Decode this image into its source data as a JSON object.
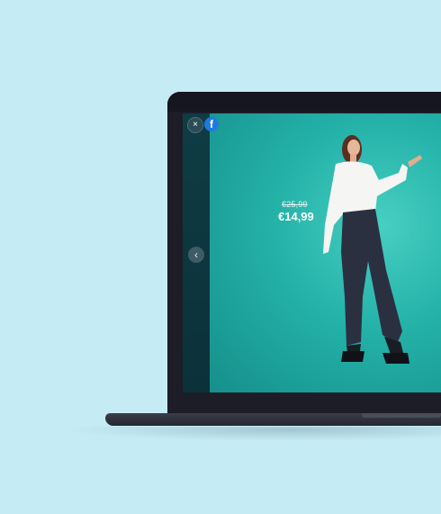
{
  "viewer": {
    "close_icon": "×",
    "facebook_icon": "f",
    "prev_icon": "‹"
  },
  "product": {
    "old_price": "€25,99",
    "new_price": "€14,99"
  },
  "colors": {
    "background": "#c5ebf4",
    "backdrop": "#23b1a8",
    "laptop": "#1c1d27"
  }
}
